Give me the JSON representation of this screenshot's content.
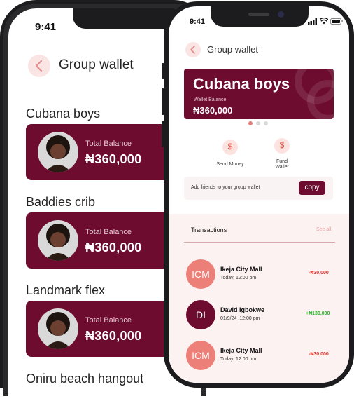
{
  "back_screen": {
    "time": "9:41",
    "title": "Group wallet",
    "groups": [
      {
        "name": "Cubana boys",
        "balance_label": "Total Balance",
        "balance": "₦360,000"
      },
      {
        "name": "Baddies crib",
        "balance_label": "Total Balance",
        "balance": "₦360,000"
      },
      {
        "name": "Landmark flex",
        "balance_label": "Total Balance",
        "balance": "₦360,000"
      },
      {
        "name": "Oniru beach hangout"
      }
    ]
  },
  "front_screen": {
    "time": "9:41",
    "title": "Group wallet",
    "wallet": {
      "name": "Cubana boys",
      "balance_label": "Wallet Balance",
      "balance": "₦360,000"
    },
    "carousel": {
      "total": 3,
      "active": 0
    },
    "actions": [
      {
        "label": "Send Money",
        "icon": "send-money-icon"
      },
      {
        "label": "Fund Wallet",
        "icon": "fund-wallet-icon"
      }
    ],
    "add_friends": {
      "text": "Add friends to your group wallet",
      "button": "copy"
    },
    "transactions": {
      "title": "Transactions",
      "see_all": "See all",
      "items": [
        {
          "initials": "ICM",
          "name": "Ikeja City Mall",
          "date": "Today, 12:00 pm",
          "amount": "-₦30,000",
          "type": "debit"
        },
        {
          "initials": "DI",
          "name": "David Igbokwe",
          "date": "01/9/24 ,12:00 pm",
          "amount": "+₦130,000",
          "type": "credit"
        },
        {
          "initials": "ICM",
          "name": "Ikeja City Mall",
          "date": "Today, 12:00 pm",
          "amount": "-₦30,000",
          "type": "debit"
        }
      ]
    }
  },
  "colors": {
    "brand": "#6e0c2f",
    "accent_pink": "#fbe4e4",
    "avatar_coral": "#ec7f77",
    "debit": "#d8342c",
    "credit": "#2bb32b"
  }
}
